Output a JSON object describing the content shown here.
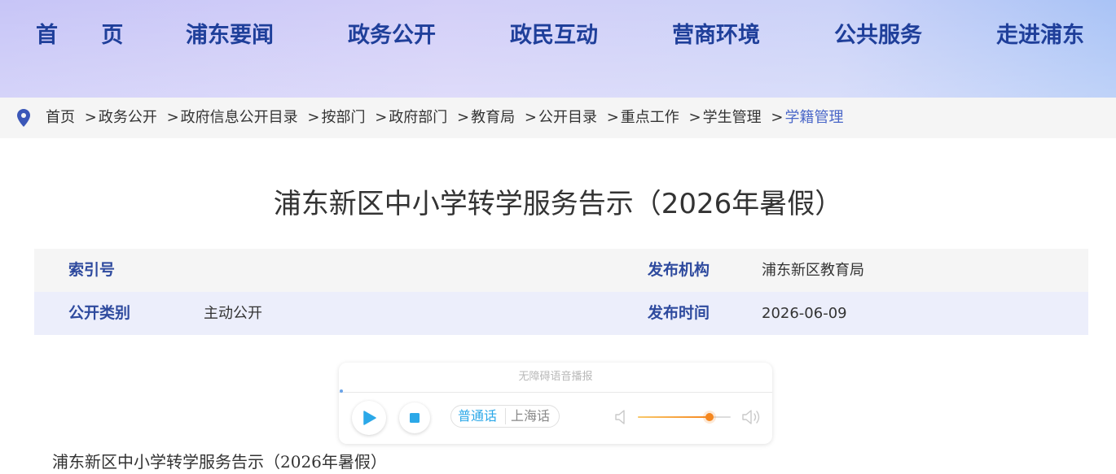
{
  "nav": {
    "items": [
      "首 页",
      "浦东要闻",
      "政务公开",
      "政民互动",
      "营商环境",
      "公共服务",
      "走进浦东"
    ]
  },
  "breadcrumb": {
    "items": [
      "首页",
      "政务公开",
      "政府信息公开目录",
      "按部门",
      "政府部门",
      "教育局",
      "公开目录",
      "重点工作",
      "学生管理",
      "学籍管理"
    ],
    "separator": ">",
    "icon": "location-pin-icon"
  },
  "article": {
    "title": "浦东新区中小学转学服务告示（2026年暑假）",
    "body_first_line": "浦东新区中小学转学服务告示（2026年暑假）"
  },
  "meta": {
    "index_label": "索引号",
    "index_value": "",
    "publisher_label": "发布机构",
    "publisher_value": "浦东新区教育局",
    "category_label": "公开类别",
    "category_value": "主动公开",
    "date_label": "发布时间",
    "date_value": "2026-06-09"
  },
  "player": {
    "header": "无障碍语音播报",
    "lang_mandarin": "普通话",
    "lang_shanghai": "上海话",
    "selected_lang": "普通话",
    "volume_level": 0.77,
    "accent_color": "#2ba8e8",
    "volume_color": "#f5871f"
  },
  "colors": {
    "nav_text": "#1f3f9a",
    "label_text": "#2e4a9e",
    "current_crumb": "#4a67c8"
  }
}
